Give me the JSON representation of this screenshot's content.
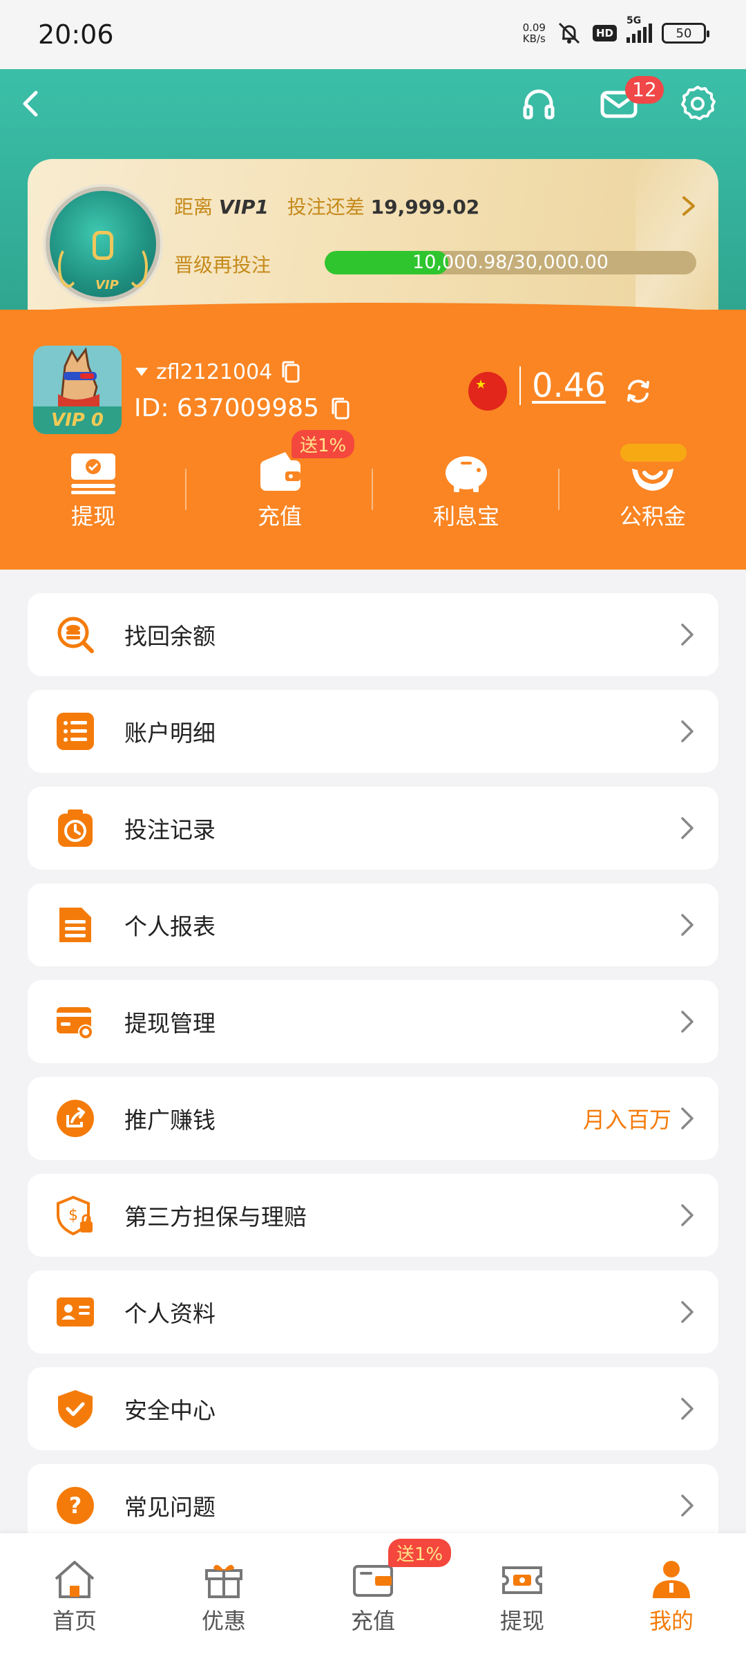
{
  "status": {
    "time": "20:06",
    "net_speed": "0.09",
    "net_unit": "KB/s",
    "hd": "HD",
    "network": "5G",
    "battery": "50"
  },
  "header": {
    "unread_messages": "12"
  },
  "vip": {
    "prefix": "距离",
    "level": "VIP1",
    "bet_gap_label": "投注还差",
    "bet_gap_amount": "19,999.02",
    "upgrade_label": "晋级再投注",
    "progress_text": "10,000.98/30,000.00",
    "progress": 0.333,
    "medal_level": "0",
    "medal_text": "VIP"
  },
  "user": {
    "name": "zfl2121004",
    "id": "ID: 637009985",
    "avatar_vip": "VIP 0",
    "balance": "0.46"
  },
  "quick_actions": [
    {
      "label": "提现",
      "icon": "withdraw-icon"
    },
    {
      "label": "充值",
      "icon": "wallet-icon"
    },
    {
      "label": "利息宝",
      "icon": "piggy-bank-icon"
    },
    {
      "label": "公积金",
      "icon": "fund-hands-icon"
    }
  ],
  "recharge_bonus": "送1%",
  "menu": [
    {
      "label": "找回余额",
      "icon": "search-coin-icon"
    },
    {
      "label": "账户明细",
      "icon": "list-icon"
    },
    {
      "label": "投注记录",
      "icon": "clock-record-icon"
    },
    {
      "label": "个人报表",
      "icon": "report-icon"
    },
    {
      "label": "提现管理",
      "icon": "card-gear-icon"
    },
    {
      "label": "推广赚钱",
      "icon": "share-icon",
      "extra": "月入百万"
    },
    {
      "label": "第三方担保与理赔",
      "icon": "shield-lock-icon"
    },
    {
      "label": "个人资料",
      "icon": "id-card-icon"
    },
    {
      "label": "安全中心",
      "icon": "shield-check-icon"
    },
    {
      "label": "常见问题",
      "icon": "question-icon"
    }
  ],
  "bottom_nav": [
    {
      "label": "首页",
      "icon": "home-icon"
    },
    {
      "label": "优惠",
      "icon": "gift-icon"
    },
    {
      "label": "充值",
      "icon": "wallet-icon"
    },
    {
      "label": "提现",
      "icon": "ticket-icon"
    },
    {
      "label": "我的",
      "icon": "user-icon",
      "active": true
    }
  ],
  "colors": {
    "teal": "#2fa58f",
    "orange": "#fa8522",
    "accent": "#f47b0a",
    "badge_red": "#f04848"
  }
}
